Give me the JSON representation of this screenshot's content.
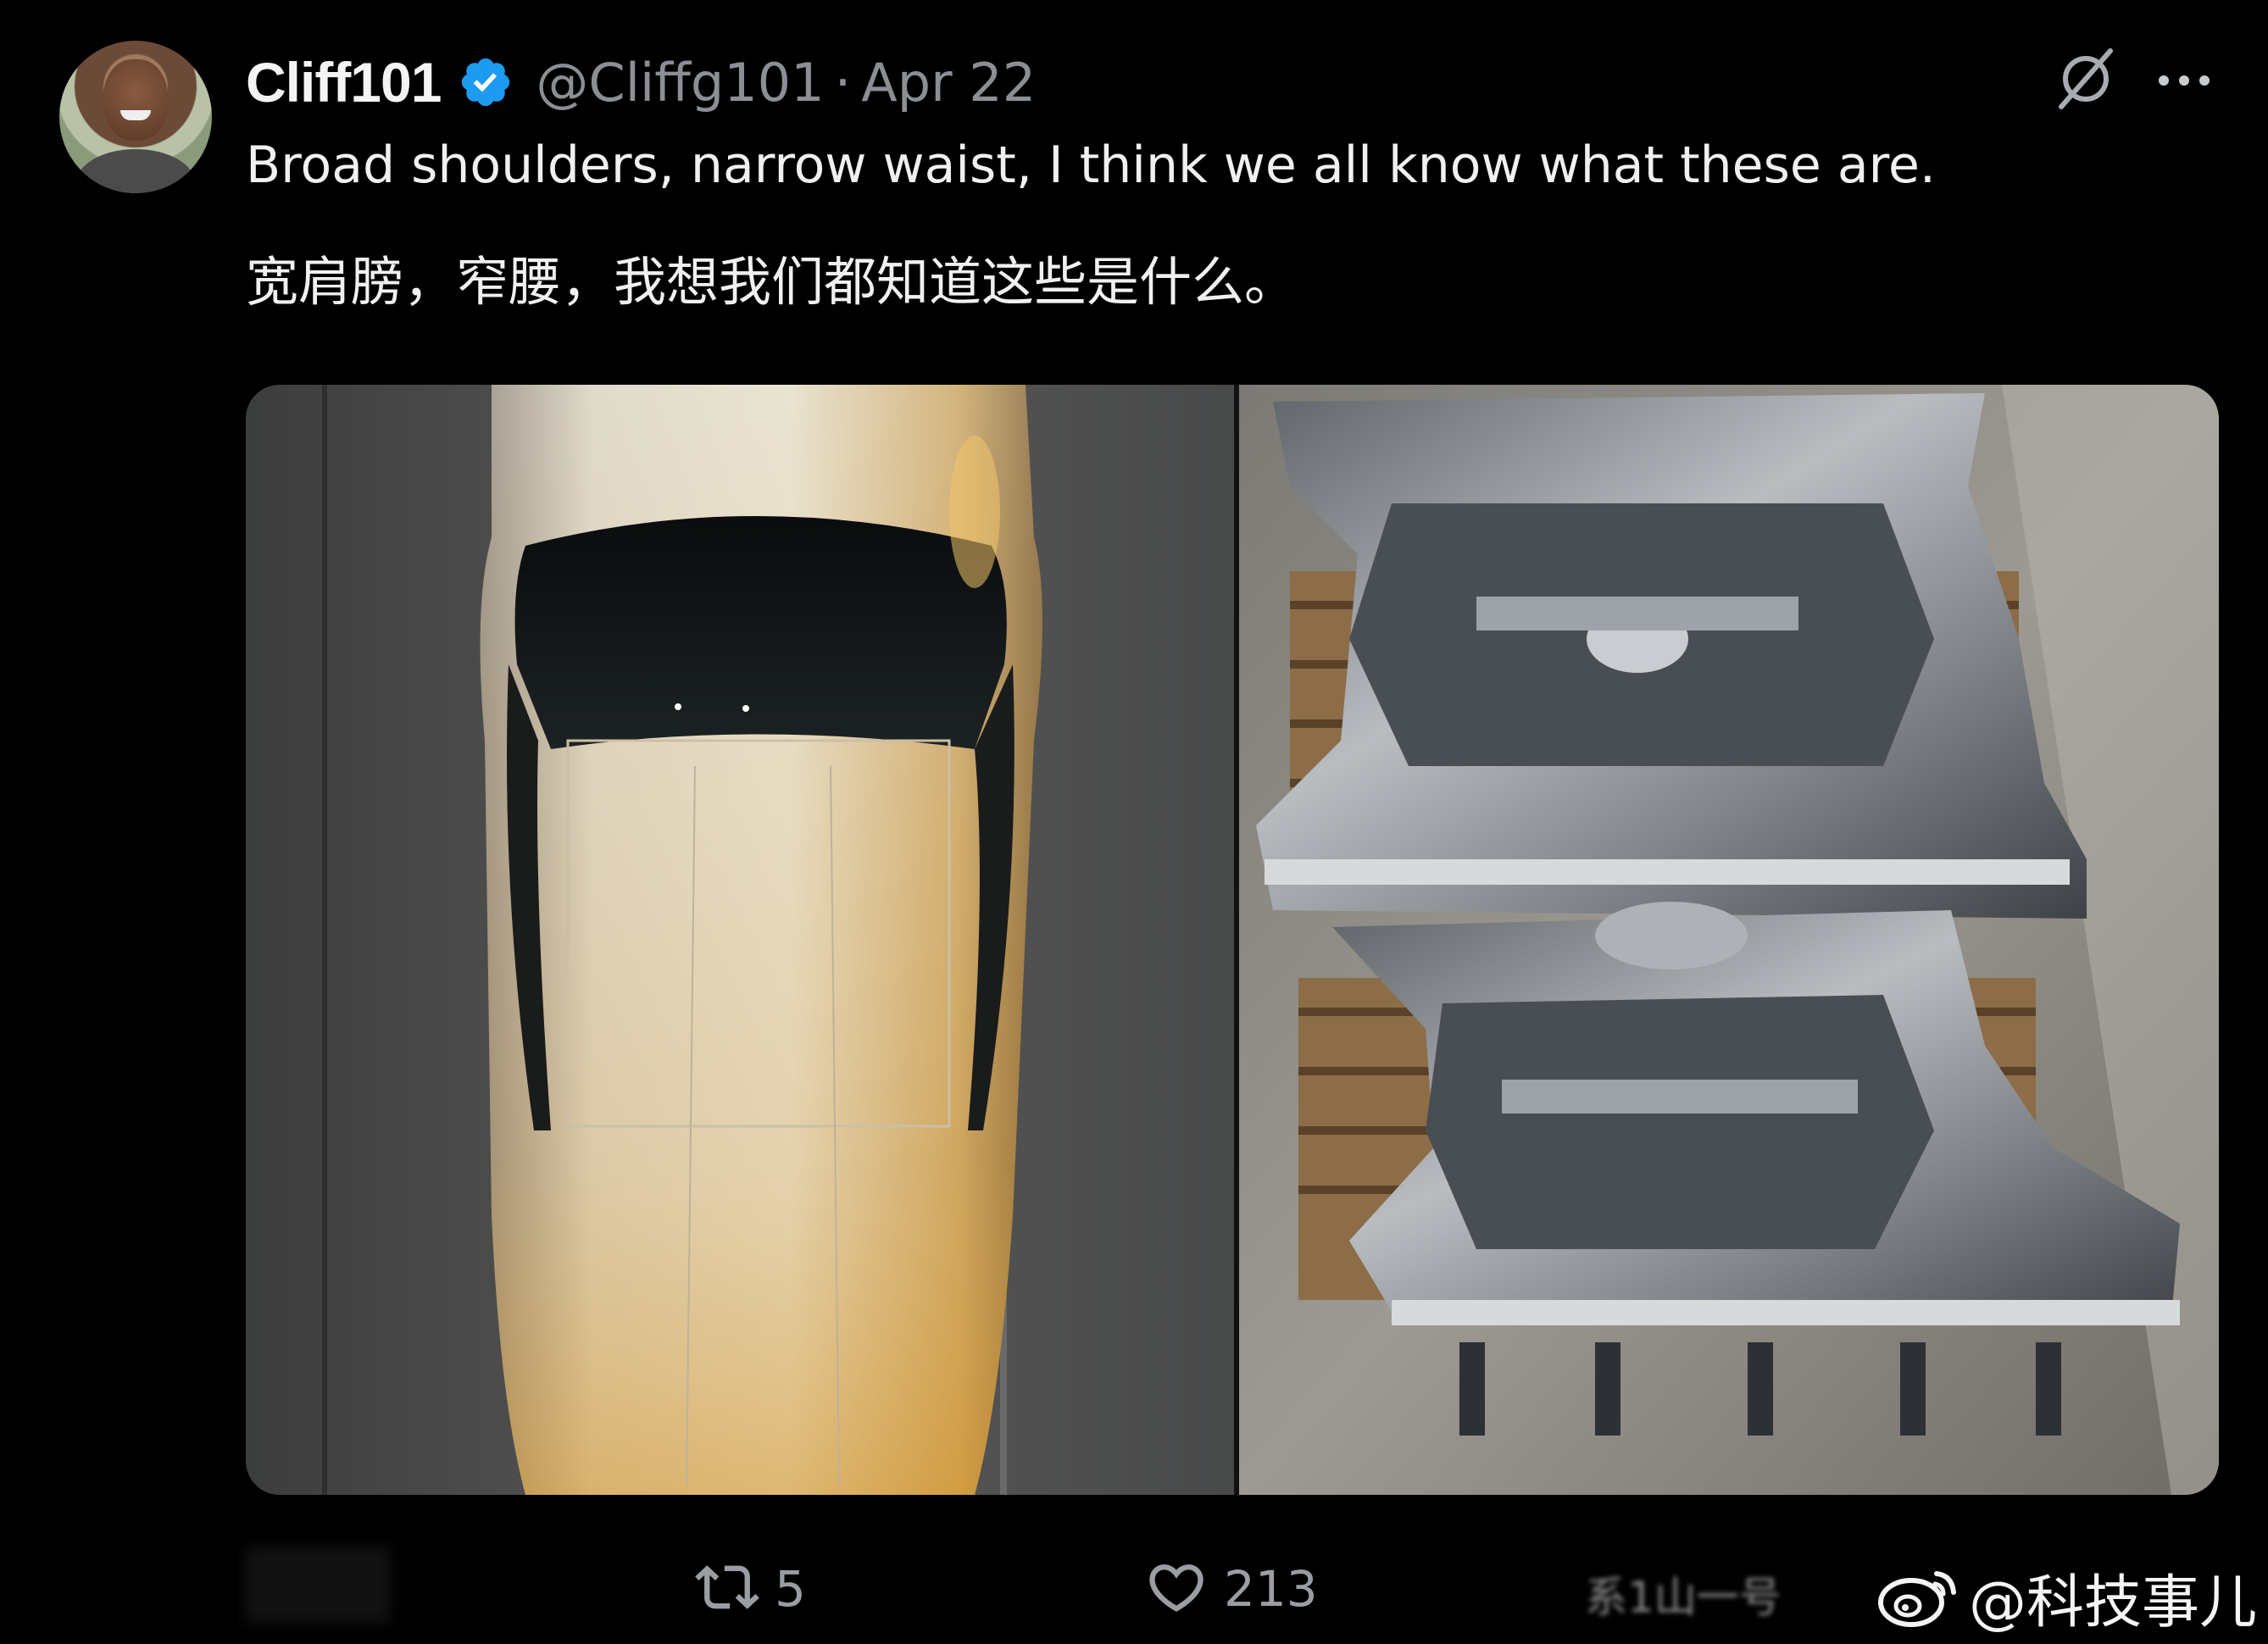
{
  "author": {
    "display_name": "Cliff101",
    "handle": "@Cliffg101",
    "separator": "·",
    "date": "Apr 22",
    "verified": true
  },
  "tweet": {
    "text_en": "Broad shoulders, narrow waist, I think we all know what these are.",
    "text_zh": "宽肩膀，窄腰，我想我们都知道这些是什么。"
  },
  "icons": {
    "grok": "grok-icon",
    "more": "more-icon",
    "retweet": "retweet-icon",
    "like": "heart-icon",
    "watermark": "weibo-icon"
  },
  "stats": {
    "retweets": "5",
    "likes": "213"
  },
  "blurred": {
    "right_label": "系1山一号"
  },
  "watermark": {
    "text": "@科技事儿"
  },
  "colors": {
    "background": "#000000",
    "text": "#f0f0f0",
    "muted": "#8b8f94",
    "verified": "#1d9bf0"
  }
}
